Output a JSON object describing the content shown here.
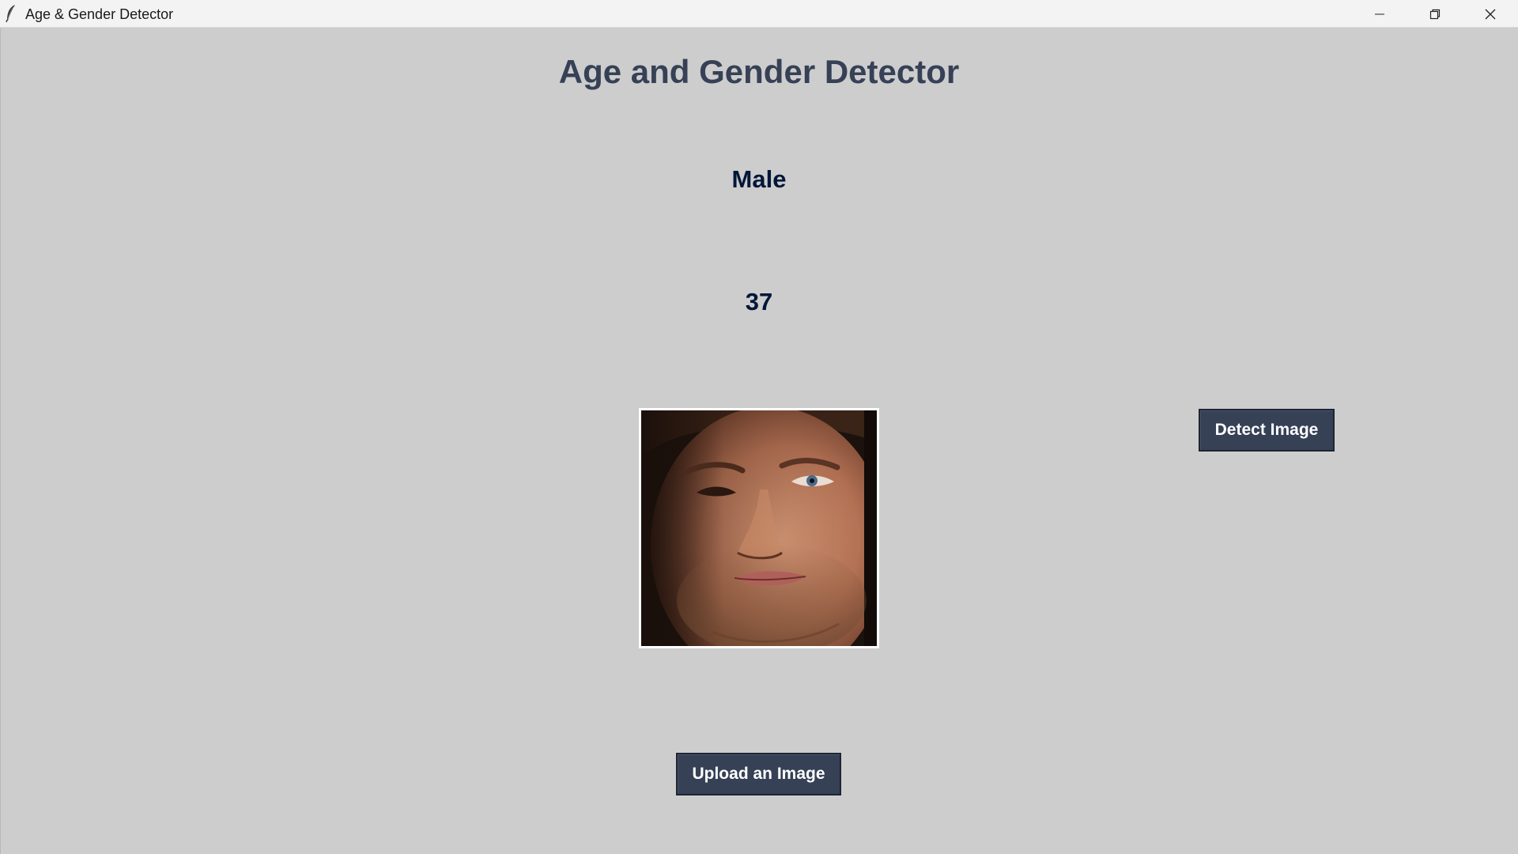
{
  "window": {
    "title": "Age & Gender Detector",
    "icon": "feather-icon",
    "controls": {
      "minimize_icon": "minimize-icon",
      "restore_icon": "restore-icon",
      "close_icon": "close-icon"
    }
  },
  "main": {
    "heading": "Age and Gender Detector",
    "gender": "Male",
    "age": "37",
    "photo": "uploaded-face-photo",
    "detect_button_label": "Detect Image",
    "upload_button_label": "Upload an Image"
  },
  "colors": {
    "background": "#cdcdcd",
    "heading": "#364156",
    "result_text": "#011638",
    "button_bg": "#364156",
    "button_text": "#ffffff"
  }
}
